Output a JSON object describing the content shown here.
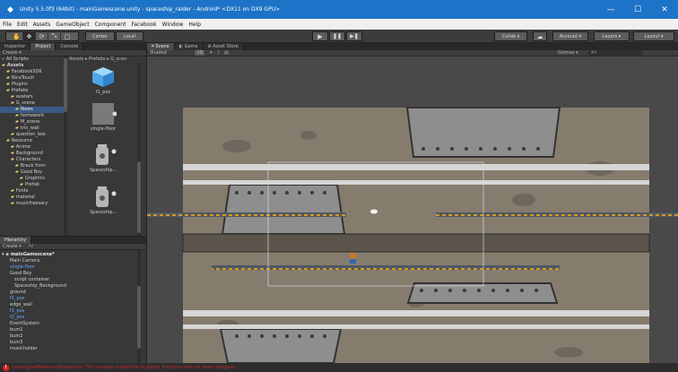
{
  "window": {
    "title": "Unity 5.5.0f3 (64bit) - mainGamescene.unity - spaceship_raider - Android* <DX11 on DX9 GPU>",
    "minimize": "—",
    "maximize": "☐",
    "close": "✕"
  },
  "menu": [
    "File",
    "Edit",
    "Assets",
    "GameObject",
    "Component",
    "Facebook",
    "Window",
    "Help"
  ],
  "toolbar": {
    "center": "Center",
    "local": "Local",
    "collab": "Collab ▾",
    "account": "Account ▾",
    "layers": "Layers ▾",
    "layout": "Layout ▾"
  },
  "project_panel": {
    "tabs": [
      "Inspector",
      "Project",
      "Console"
    ],
    "create": "Create ▾",
    "breadcrumb": "Assets ▸ Prefabs ▸ G_scen",
    "tree": [
      {
        "label": "All Scripts",
        "indent": 0,
        "bold": false
      },
      {
        "label": "Assets",
        "indent": 0,
        "bold": true
      },
      {
        "label": "FacebookSDK",
        "indent": 1
      },
      {
        "label": "NiceTouch",
        "indent": 1
      },
      {
        "label": "Plugins",
        "indent": 1
      },
      {
        "label": "Prefabs",
        "indent": 1
      },
      {
        "label": "avatars",
        "indent": 2
      },
      {
        "label": "G_scene",
        "indent": 2
      },
      {
        "label": "floors",
        "indent": 3,
        "selected": true
      },
      {
        "label": "homework",
        "indent": 3
      },
      {
        "label": "M_scene",
        "indent": 3
      },
      {
        "label": "trix_wall",
        "indent": 3
      },
      {
        "label": "question_box",
        "indent": 2
      },
      {
        "label": "Resource",
        "indent": 1
      },
      {
        "label": "Anime",
        "indent": 2
      },
      {
        "label": "Background",
        "indent": 2
      },
      {
        "label": "Characters",
        "indent": 2
      },
      {
        "label": "Brauk from",
        "indent": 3
      },
      {
        "label": "Good Boy",
        "indent": 3
      },
      {
        "label": "Graphics",
        "indent": 4
      },
      {
        "label": "Prefab",
        "indent": 4
      },
      {
        "label": "Fonts",
        "indent": 2
      },
      {
        "label": "material",
        "indent": 2
      },
      {
        "label": "musicfreesary",
        "indent": 2
      }
    ],
    "assets": [
      {
        "label": "f1_pos",
        "kind": "cube"
      },
      {
        "label": "single-floor",
        "kind": "grey"
      },
      {
        "label": "Spaceship...",
        "kind": "jar"
      },
      {
        "label": "Spaceship...",
        "kind": "jar"
      }
    ]
  },
  "hierarchy_panel": {
    "tab": "Hierarchy",
    "create": "Create ▾",
    "search": "All",
    "scene": "mainGamescene*",
    "items": [
      {
        "label": "Main Camera",
        "indent": 1,
        "blue": false
      },
      {
        "label": "single-floor",
        "indent": 1,
        "blue": true
      },
      {
        "label": "Good Boy",
        "indent": 1,
        "blue": false
      },
      {
        "label": "script container",
        "indent": 2,
        "blue": false
      },
      {
        "label": "Spaceship_Background",
        "indent": 2,
        "blue": false
      },
      {
        "label": "ground",
        "indent": 1,
        "blue": false
      },
      {
        "label": "f1_pos",
        "indent": 1,
        "blue": true
      },
      {
        "label": "edge_wall",
        "indent": 1,
        "blue": false
      },
      {
        "label": "f1_pos",
        "indent": 1,
        "blue": true
      },
      {
        "label": "f2_pos",
        "indent": 1,
        "blue": true
      },
      {
        "label": "EventSystem",
        "indent": 1,
        "blue": false
      },
      {
        "label": "bum1",
        "indent": 1,
        "blue": false
      },
      {
        "label": "bum2",
        "indent": 1,
        "blue": false
      },
      {
        "label": "bum3",
        "indent": 1,
        "blue": false
      },
      {
        "label": "musicholder",
        "indent": 1,
        "blue": false
      }
    ]
  },
  "scene_panel": {
    "tabs": [
      "Scene",
      "Game",
      "Asset Store"
    ],
    "shading": "Shaded",
    "mode": "2D",
    "gizmos": "Gizmos ▾",
    "search": "All"
  },
  "status": {
    "message": "UnassignedReferenceException: The variable shootDone of globol_functions has not been assigned."
  },
  "colors": {
    "titlebar": "#1d73c7",
    "panel": "#383838",
    "scene_bg": "#494949",
    "wall": "#857c6e",
    "metal": "#8e8e8e",
    "error": "#c52a2a",
    "prefab_text": "#6ea8ff"
  }
}
